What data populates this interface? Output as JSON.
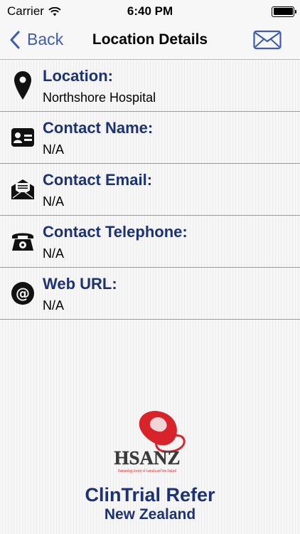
{
  "status_bar": {
    "carrier": "Carrier",
    "time": "6:40 PM",
    "battery_level": 1.0,
    "icons": [
      "wifi-icon",
      "battery-icon"
    ]
  },
  "nav": {
    "back_label": "Back",
    "title": "Location Details",
    "right_icon": "mail-icon",
    "accent_color": "#3c5bb5"
  },
  "rows": [
    {
      "label": "Location:",
      "value": "Northshore Hospital",
      "icon": "map-pin-icon"
    },
    {
      "label": "Contact Name:",
      "value": "N/A",
      "icon": "contact-card-icon"
    },
    {
      "label": "Contact Email:",
      "value": "N/A",
      "icon": "envelope-icon"
    },
    {
      "label": "Contact Telephone:",
      "value": "N/A",
      "icon": "telephone-icon"
    },
    {
      "label": "Web URL:",
      "value": "N/A",
      "icon": "at-sign-icon"
    }
  ],
  "branding": {
    "logo_text": "HSANZ",
    "logo_subtext": "Haematology Society of Australia and New Zealand",
    "app_title": "ClinTrial Refer",
    "app_subtitle": "New Zealand",
    "label_color": "#1c3276",
    "logo_color": "#d8232a"
  }
}
